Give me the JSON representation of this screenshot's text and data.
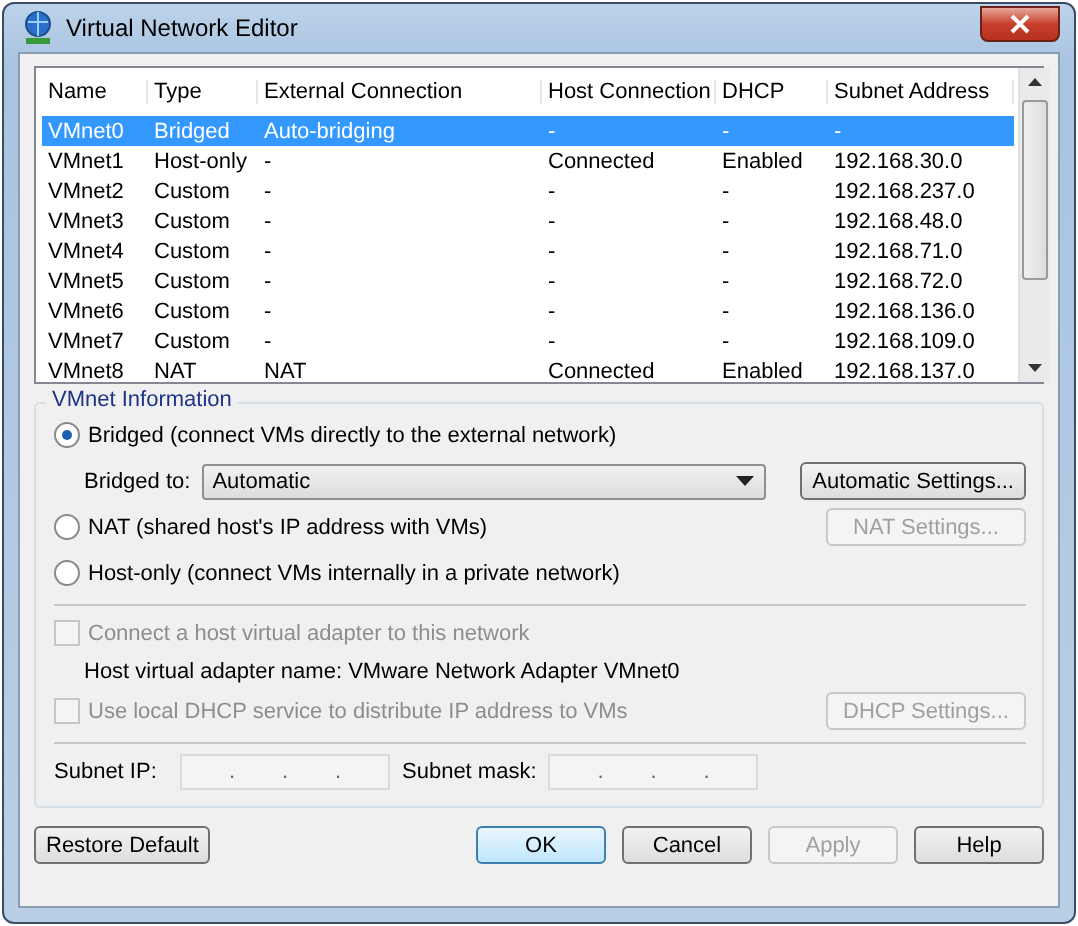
{
  "window": {
    "title": "Virtual Network Editor"
  },
  "table": {
    "columns": [
      "Name",
      "Type",
      "External Connection",
      "Host Connection",
      "DHCP",
      "Subnet Address"
    ],
    "rows": [
      {
        "cells": [
          "VMnet0",
          "Bridged",
          "Auto-bridging",
          "-",
          "-",
          "-"
        ],
        "selected": true
      },
      {
        "cells": [
          "VMnet1",
          "Host-only",
          "-",
          "Connected",
          "Enabled",
          "192.168.30.0"
        ],
        "selected": false
      },
      {
        "cells": [
          "VMnet2",
          "Custom",
          "-",
          "-",
          "-",
          "192.168.237.0"
        ],
        "selected": false
      },
      {
        "cells": [
          "VMnet3",
          "Custom",
          "-",
          "-",
          "-",
          "192.168.48.0"
        ],
        "selected": false
      },
      {
        "cells": [
          "VMnet4",
          "Custom",
          "-",
          "-",
          "-",
          "192.168.71.0"
        ],
        "selected": false
      },
      {
        "cells": [
          "VMnet5",
          "Custom",
          "-",
          "-",
          "-",
          "192.168.72.0"
        ],
        "selected": false
      },
      {
        "cells": [
          "VMnet6",
          "Custom",
          "-",
          "-",
          "-",
          "192.168.136.0"
        ],
        "selected": false
      },
      {
        "cells": [
          "VMnet7",
          "Custom",
          "-",
          "-",
          "-",
          "192.168.109.0"
        ],
        "selected": false
      },
      {
        "cells": [
          "VMnet8",
          "NAT",
          "NAT",
          "Connected",
          "Enabled",
          "192.168.137.0"
        ],
        "selected": false
      }
    ]
  },
  "vmnet_info": {
    "title": "VMnet Information",
    "bridged": {
      "label": "Bridged (connect VMs directly to the external network)",
      "selected": true
    },
    "bridged_to": {
      "label": "Bridged to:",
      "value": "Automatic",
      "button": {
        "label": "Automatic Settings...",
        "disabled": false
      }
    },
    "nat": {
      "label": "NAT (shared host's IP address with VMs)",
      "selected": false,
      "button": {
        "label": "NAT Settings...",
        "disabled": true
      }
    },
    "host_only": {
      "label": "Host-only (connect VMs internally in a private network)",
      "selected": false
    },
    "connect_adapter": {
      "label": "Connect a host virtual adapter to this network",
      "checked": false,
      "disabled": true
    },
    "adapter_name": "Host virtual adapter name: VMware Network Adapter VMnet0",
    "dhcp": {
      "label": "Use local DHCP service to distribute IP address to VMs",
      "checked": false,
      "disabled": true,
      "button": {
        "label": "DHCP Settings...",
        "disabled": true
      }
    },
    "subnet_ip": {
      "label": "Subnet IP:",
      "dots": [
        ".",
        ".",
        "."
      ]
    },
    "subnet_mask": {
      "label": "Subnet mask:",
      "dots": [
        ".",
        ".",
        "."
      ]
    }
  },
  "buttons": [
    {
      "label": "Restore Default",
      "disabled": false,
      "default": false
    },
    {
      "label": "OK",
      "disabled": false,
      "default": true
    },
    {
      "label": "Cancel",
      "disabled": false,
      "default": false
    },
    {
      "label": "Apply",
      "disabled": true,
      "default": false
    },
    {
      "label": "Help",
      "disabled": false,
      "default": false
    }
  ]
}
